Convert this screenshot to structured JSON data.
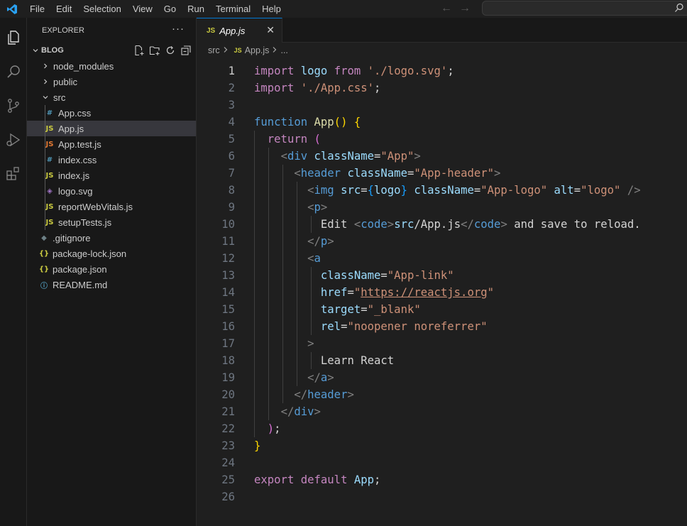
{
  "menu": [
    "File",
    "Edit",
    "Selection",
    "View",
    "Go",
    "Run",
    "Terminal",
    "Help"
  ],
  "icons": {
    "logo": "vscode-logo-icon",
    "activity": [
      "files-icon",
      "search-icon",
      "source-control-icon",
      "run-debug-icon",
      "extensions-icon"
    ]
  },
  "sidebar": {
    "title": "EXPLORER",
    "more": "···",
    "section": "BLOG",
    "tree": [
      {
        "label": "node_modules",
        "type": "folder",
        "expanded": false
      },
      {
        "label": "public",
        "type": "folder",
        "expanded": false
      },
      {
        "label": "src",
        "type": "folder",
        "expanded": true
      },
      {
        "label": "App.css",
        "type": "css",
        "glyph": "#"
      },
      {
        "label": "App.js",
        "type": "js",
        "glyph": "JS",
        "selected": true
      },
      {
        "label": "App.test.js",
        "type": "test",
        "glyph": "JS"
      },
      {
        "label": "index.css",
        "type": "css",
        "glyph": "#"
      },
      {
        "label": "index.js",
        "type": "js",
        "glyph": "JS"
      },
      {
        "label": "logo.svg",
        "type": "svg",
        "glyph": "◈"
      },
      {
        "label": "reportWebVitals.js",
        "type": "js",
        "glyph": "JS"
      },
      {
        "label": "setupTests.js",
        "type": "js",
        "glyph": "JS"
      },
      {
        "label": ".gitignore",
        "type": "git",
        "glyph": "◆"
      },
      {
        "label": "package-lock.json",
        "type": "json",
        "glyph": "{}"
      },
      {
        "label": "package.json",
        "type": "json",
        "glyph": "{}"
      },
      {
        "label": "README.md",
        "type": "md",
        "glyph": "ⓘ"
      }
    ]
  },
  "editor": {
    "tab": {
      "badge": "JS",
      "label": "App.js",
      "close": "✕"
    },
    "breadcrumb": {
      "root": "src",
      "badge": "JS",
      "file": "App.js",
      "ellipsis": "..."
    },
    "active_line": 1,
    "lines": [
      "import logo from './logo.svg';",
      "import './App.css';",
      "",
      "function App() {",
      "  return (",
      "    <div className=\"App\">",
      "      <header className=\"App-header\">",
      "        <img src={logo} className=\"App-logo\" alt=\"logo\" />",
      "        <p>",
      "          Edit <code>src/App.js</code> and save to reload.",
      "        </p>",
      "        <a",
      "          className=\"App-link\"",
      "          href=\"https://reactjs.org\"",
      "          target=\"_blank\"",
      "          rel=\"noopener noreferrer\"",
      "        >",
      "          Learn React",
      "        </a>",
      "      </header>",
      "    </div>",
      "  );",
      "}",
      "",
      "export default App;",
      ""
    ]
  }
}
